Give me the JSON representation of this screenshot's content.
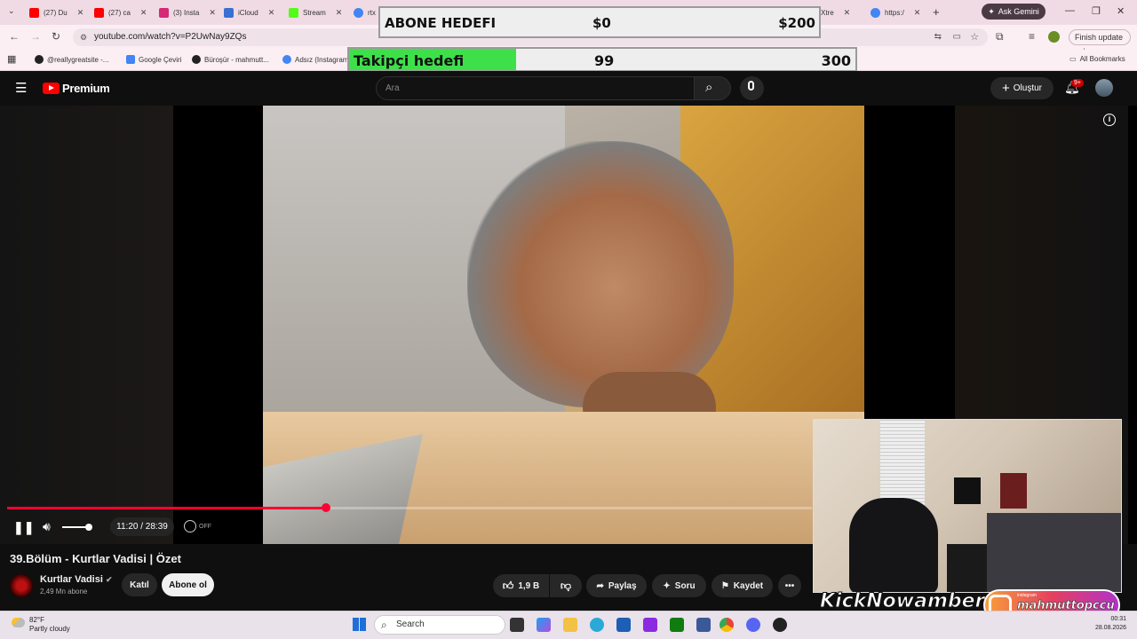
{
  "browser": {
    "tabs": [
      {
        "label": "(27) Du",
        "color": "#ff0000"
      },
      {
        "label": "(27) ca",
        "color": "#ff0000"
      },
      {
        "label": "(3) Insta",
        "color": "#d62976"
      },
      {
        "label": "iCloud",
        "color": "#3b6fd1"
      },
      {
        "label": "Stream",
        "color": "#53fc18"
      },
      {
        "label": "rtx",
        "color": "#4285f4"
      },
      {
        "label": "Xtre",
        "color": "#555555"
      },
      {
        "label": "https:/",
        "color": "#4285f4"
      }
    ],
    "gemini_label": "Ask Gemini",
    "url": "youtube.com/watch?v=P2UwNay9ZQs",
    "finish_update": "Finish update",
    "bookmarks": [
      "@reallygreatsite -...",
      "Google Çeviri",
      "Büroşür - mahmutt...",
      "Adsız (Instagram"
    ],
    "all_bookmarks": "All Bookmarks"
  },
  "overlay": {
    "sub_goal": {
      "label": "ABONE HEDEFI",
      "current": "$0",
      "target": "$200"
    },
    "follow_goal": {
      "label": "Takipçi hedefi",
      "current": "99",
      "target": "300",
      "progress": 0.33
    }
  },
  "youtube": {
    "logo": "Premium",
    "search_placeholder": "Ara",
    "create_label": "Oluştur",
    "notif_count": "9+",
    "player": {
      "time": "11:20 / 28:39",
      "progress": 0.396,
      "autoplay": "OFF"
    },
    "video_title": "39.Bölüm - Kurtlar Vadisi | Özet",
    "channel_name": "Kurtlar Vadisi",
    "subscribers": "2,49 Mn abone",
    "join_label": "Katıl",
    "subscribe_label": "Abone ol",
    "likes": "1,9 B",
    "share_label": "Paylaş",
    "ask_label": "Soru",
    "save_label": "Kaydet"
  },
  "stream": {
    "kick_text": "KickNowamber",
    "instagram_small": "instagram",
    "instagram_handle": "mahmuttopccu"
  },
  "taskbar": {
    "weather_temp": "82°F",
    "weather_desc": "Partly cloudy",
    "search_label": "Search",
    "time": "00:31",
    "date": "28.08.2026"
  }
}
